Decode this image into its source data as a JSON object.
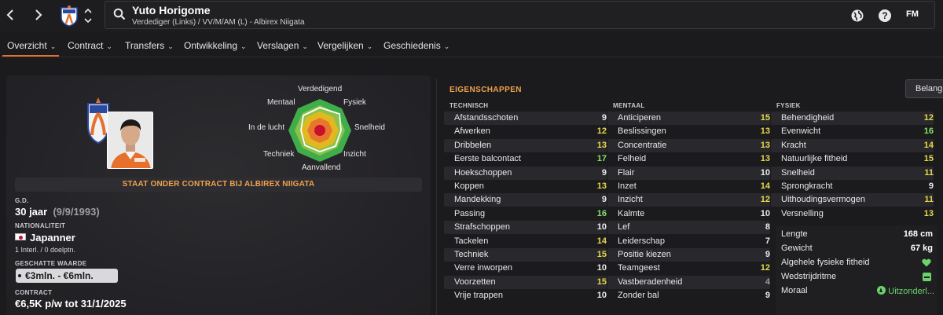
{
  "header": {
    "player_name": "Yuto Horigome",
    "player_subtitle": "Verdediger (Links) / VV/M/AM (L) - Albirex Niigata",
    "fm_logo": "FM",
    "icons": [
      "back-arrow-icon",
      "forward-arrow-icon",
      "club-badge-icon",
      "up-down-icon",
      "search-icon",
      "world-icon",
      "help-icon"
    ]
  },
  "tabs": [
    {
      "label": "Overzicht",
      "active": true
    },
    {
      "label": "Contract"
    },
    {
      "label": "Transfers"
    },
    {
      "label": "Ontwikkeling"
    },
    {
      "label": "Verslagen"
    },
    {
      "label": "Vergelijken"
    },
    {
      "label": "Geschiedenis"
    }
  ],
  "tab_chevron": "⌄",
  "radar": {
    "labels": {
      "top": "Verdedigend",
      "top_left": "Mentaal",
      "top_right": "Fysiek",
      "left": "In de lucht",
      "right": "Snelheid",
      "bottom_left": "Techniek",
      "bottom_right": "Inzicht",
      "bottom": "Aanvallend"
    }
  },
  "profile": {
    "contract_banner": "STAAT ONDER CONTRACT BIJ ALBIREX NIIGATA",
    "dob_label": "G.D.",
    "age": "30 jaar",
    "dob": "(9/9/1993)",
    "nationality_label": "NATIONALITEIT",
    "nationality": "Japanner",
    "caps": "1 Interl. / 0 doelptn.",
    "value_label": "GESCHATTE WAARDE",
    "value": "€3mln. - €6mln.",
    "contract_label": "CONTRACT",
    "contract": "€6,5K p/w tot 31/1/2025"
  },
  "attributes": {
    "title": "EIGENSCHAPPEN",
    "sort_button": "Belangrijk",
    "technical_label": "TECHNISCH",
    "mental_label": "MENTAAL",
    "physical_label": "FYSIEK",
    "technical": [
      {
        "name": "Afstandsschoten",
        "value": "9"
      },
      {
        "name": "Afwerken",
        "value": "12"
      },
      {
        "name": "Dribbelen",
        "value": "13"
      },
      {
        "name": "Eerste balcontact",
        "value": "17"
      },
      {
        "name": "Hoekschoppen",
        "value": "9"
      },
      {
        "name": "Koppen",
        "value": "13"
      },
      {
        "name": "Mandekking",
        "value": "9"
      },
      {
        "name": "Passing",
        "value": "16"
      },
      {
        "name": "Strafschoppen",
        "value": "10"
      },
      {
        "name": "Tackelen",
        "value": "14"
      },
      {
        "name": "Techniek",
        "value": "15"
      },
      {
        "name": "Verre inworpen",
        "value": "10"
      },
      {
        "name": "Voorzetten",
        "value": "15"
      },
      {
        "name": "Vrije trappen",
        "value": "10"
      }
    ],
    "mental": [
      {
        "name": "Anticiperen",
        "value": "15"
      },
      {
        "name": "Beslissingen",
        "value": "13"
      },
      {
        "name": "Concentratie",
        "value": "13"
      },
      {
        "name": "Felheid",
        "value": "13"
      },
      {
        "name": "Flair",
        "value": "10"
      },
      {
        "name": "Inzet",
        "value": "14"
      },
      {
        "name": "Inzicht",
        "value": "12"
      },
      {
        "name": "Kalmte",
        "value": "10"
      },
      {
        "name": "Lef",
        "value": "8"
      },
      {
        "name": "Leiderschap",
        "value": "7"
      },
      {
        "name": "Positie kiezen",
        "value": "9"
      },
      {
        "name": "Teamgeest",
        "value": "12"
      },
      {
        "name": "Vastberadenheid",
        "value": "4"
      },
      {
        "name": "Zonder bal",
        "value": "9"
      }
    ],
    "physical": [
      {
        "name": "Behendigheid",
        "value": "12"
      },
      {
        "name": "Evenwicht",
        "value": "16"
      },
      {
        "name": "Kracht",
        "value": "14"
      },
      {
        "name": "Natuurlijke fitheid",
        "value": "15"
      },
      {
        "name": "Snelheid",
        "value": "11"
      },
      {
        "name": "Sprongkracht",
        "value": "9"
      },
      {
        "name": "Uithoudingsvermogen",
        "value": "11"
      },
      {
        "name": "Versnelling",
        "value": "13"
      }
    ],
    "physical_info": {
      "height_label": "Lengte",
      "height": "168 cm",
      "weight_label": "Gewicht",
      "weight": "67 kg",
      "fitness_label": "Algehele fysieke fitheid",
      "fitness_icon": "heart-icon",
      "rhythm_label": "Wedstrijdritme",
      "rhythm_icon": "minus-square-icon",
      "morale_label": "Moraal",
      "morale": "Uitzonderl..."
    }
  },
  "colors": {
    "accent": "#e3712f",
    "heading": "#f0a24b",
    "value_low": "#9a9aa0",
    "value_mid": "#e8e8ea",
    "value_good": "#e6d74a",
    "value_great": "#86e06a"
  }
}
